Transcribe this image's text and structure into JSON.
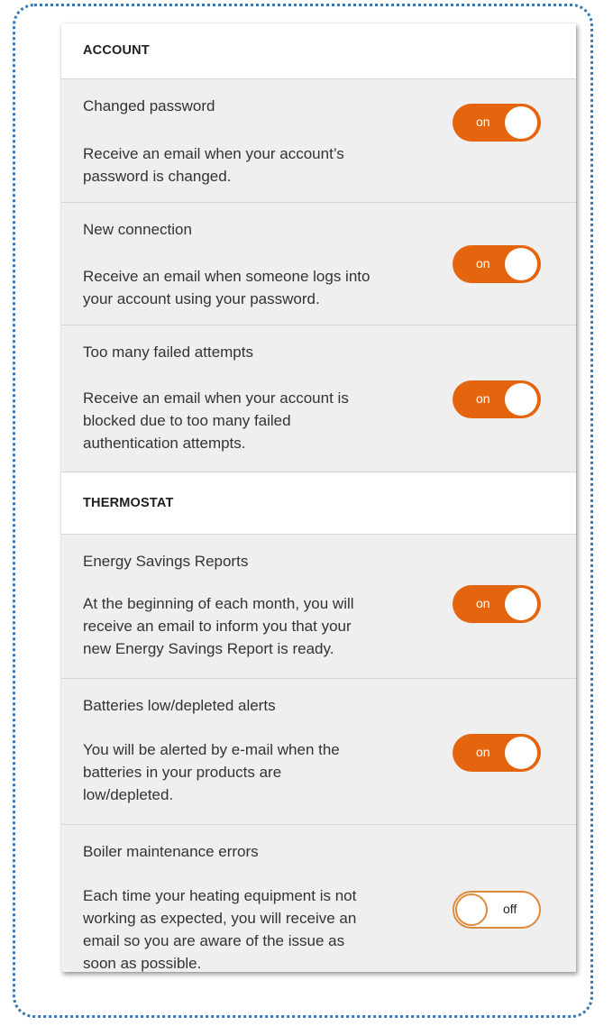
{
  "sections": [
    {
      "header": "ACCOUNT",
      "rows": [
        {
          "title": "Changed password",
          "desc": [
            "Receive an email when your account’s",
            "password is changed."
          ],
          "toggle": "on"
        },
        {
          "title": "New connection",
          "desc": [
            "Receive an email when someone logs into",
            "your account using your password."
          ],
          "toggle": "on"
        },
        {
          "title": "Too many failed attempts",
          "desc": [
            "Receive an email when your account is",
            "blocked due to too many failed",
            "authentication attempts."
          ],
          "toggle": "on"
        }
      ]
    },
    {
      "header": "THERMOSTAT",
      "rows": [
        {
          "title": "Energy Savings Reports",
          "desc": [
            "At the beginning of each month, you will",
            "receive an email to inform you that your",
            "new Energy Savings Report is ready."
          ],
          "toggle": "on"
        },
        {
          "title": "Batteries low/depleted alerts",
          "desc": [
            "You will be alerted by e-mail when the",
            "batteries in your products are",
            "low/depleted."
          ],
          "toggle": "on"
        },
        {
          "title": "Boiler maintenance errors",
          "desc": [
            "Each time your heating equipment is not",
            "working as expected, you will receive an",
            "email so you are aware of the issue as",
            "soon as possible."
          ],
          "toggle": "off"
        }
      ]
    }
  ],
  "colors": {
    "accent": "#e5650f",
    "frame_border": "#3a78b4",
    "row_background": "#efefef"
  }
}
